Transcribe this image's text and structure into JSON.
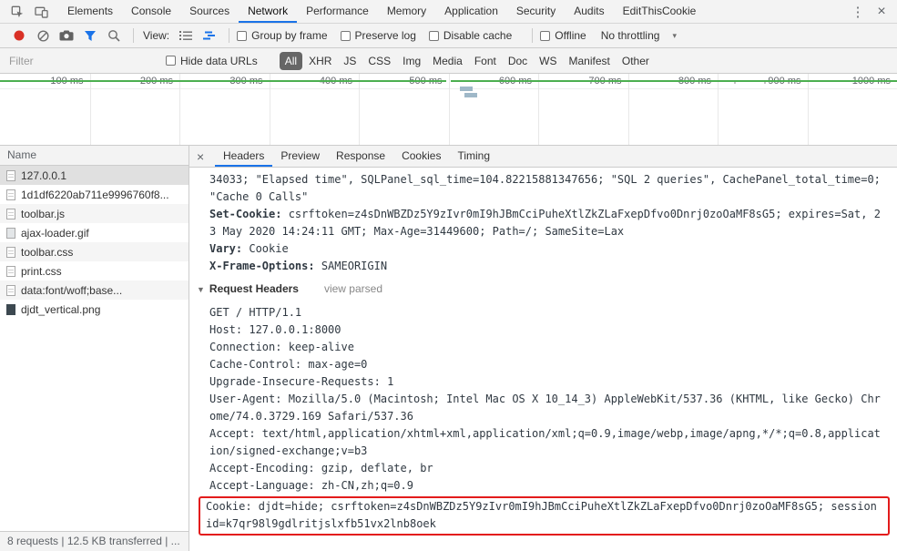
{
  "colors": {
    "accent": "#1a73e8",
    "record_red": "#d93025",
    "highlight_red": "#e31b1b",
    "timeline_green": "#4caf50",
    "pill_active_bg": "#666666"
  },
  "top_bar": {
    "tabs": [
      "Elements",
      "Console",
      "Sources",
      "Network",
      "Performance",
      "Memory",
      "Application",
      "Security",
      "Audits",
      "EditThisCookie"
    ],
    "active_tab": "Network",
    "more_menu_glyph": "⋮",
    "close_glyph": "×"
  },
  "network_toolbar": {
    "view_label": "View:",
    "checkboxes": [
      "Group by frame",
      "Preserve log",
      "Disable cache"
    ],
    "offline_label": "Offline",
    "throttling_value": "No throttling",
    "caret_glyph": "▾"
  },
  "filter_bar": {
    "filter_placeholder": "Filter",
    "hide_data_urls_label": "Hide data URLs",
    "pills": [
      "All",
      "XHR",
      "JS",
      "CSS",
      "Img",
      "Media",
      "Font",
      "Doc",
      "WS",
      "Manifest",
      "Other"
    ],
    "active_pill": "All"
  },
  "timeline": {
    "tick_labels": [
      "100 ms",
      "200 ms",
      "300 ms",
      "400 ms",
      "500 ms",
      "600 ms",
      "700 ms",
      "800 ms",
      "900 ms",
      "1000 ms"
    ],
    "axis_max_ms": 1000,
    "green_segments_ms": [
      [
        0,
        497
      ],
      [
        503,
        1000
      ]
    ],
    "activity_bars_ms": [
      {
        "start": 513,
        "width_ms": 14,
        "row": 0
      },
      {
        "start": 518,
        "width_ms": 14,
        "row": 1
      }
    ],
    "dots_ms": [
      818,
      852
    ]
  },
  "requests": {
    "column_header": "Name",
    "selected": "127.0.0.1",
    "items": [
      {
        "name": "127.0.0.1",
        "type": "document"
      },
      {
        "name": "1d1df6220ab711e9996760f8...",
        "type": "script"
      },
      {
        "name": "toolbar.js",
        "type": "script"
      },
      {
        "name": "ajax-loader.gif",
        "type": "image-light"
      },
      {
        "name": "toolbar.css",
        "type": "stylesheet"
      },
      {
        "name": "print.css",
        "type": "stylesheet"
      },
      {
        "name": "data:font/woff;base...",
        "type": "font"
      },
      {
        "name": "djdt_vertical.png",
        "type": "image-dark"
      }
    ]
  },
  "status_bar": {
    "text": "8 requests | 12.5 KB transferred | ..."
  },
  "details": {
    "tabs": [
      "Headers",
      "Preview",
      "Response",
      "Cookies",
      "Timing"
    ],
    "active_tab": "Headers",
    "close_glyph": "×",
    "headers_view": {
      "disclosure_glyph": "▼",
      "leading_overflow_lines": [
        "34033; \"Elapsed time\", SQLPanel_sql_time=104.82215881347656; \"SQL 2 queries\", CachePanel_total_time=0; \"Cache 0 Calls\""
      ],
      "response_headers": [
        {
          "name": "Set-Cookie:",
          "value": "csrftoken=z4sDnWBZDz5Y9zIvr0mI9hJBmCciPuheXtlZkZLaFxepDfvo0Dnrj0zoOaMF8sG5; expires=Sat, 23 May 2020 14:24:11 GMT; Max-Age=31449600; Path=/; SameSite=Lax"
        },
        {
          "name": "Vary:",
          "value": "Cookie"
        },
        {
          "name": "X-Frame-Options:",
          "value": "SAMEORIGIN"
        }
      ],
      "request_headers_label": "Request Headers",
      "view_parsed_label": "view parsed",
      "raw_request_lines": [
        "GET / HTTP/1.1",
        "Host: 127.0.0.1:8000",
        "Connection: keep-alive",
        "Cache-Control: max-age=0",
        "Upgrade-Insecure-Requests: 1",
        "User-Agent: Mozilla/5.0 (Macintosh; Intel Mac OS X 10_14_3) AppleWebKit/537.36 (KHTML, like Gecko) Chrome/74.0.3729.169 Safari/537.36",
        "Accept: text/html,application/xhtml+xml,application/xml;q=0.9,image/webp,image/apng,*/*;q=0.8,application/signed-exchange;v=b3",
        "Accept-Encoding: gzip, deflate, br",
        "Accept-Language: zh-CN,zh;q=0.9"
      ],
      "highlighted_cookie_line": "Cookie: djdt=hide; csrftoken=z4sDnWBZDz5Y9zIvr0mI9hJBmCciPuheXtlZkZLaFxepDfvo0Dnrj0zoOaMF8sG5; sessionid=k7qr98l9gdlritjslxfb51vx2lnb8oek"
    }
  }
}
